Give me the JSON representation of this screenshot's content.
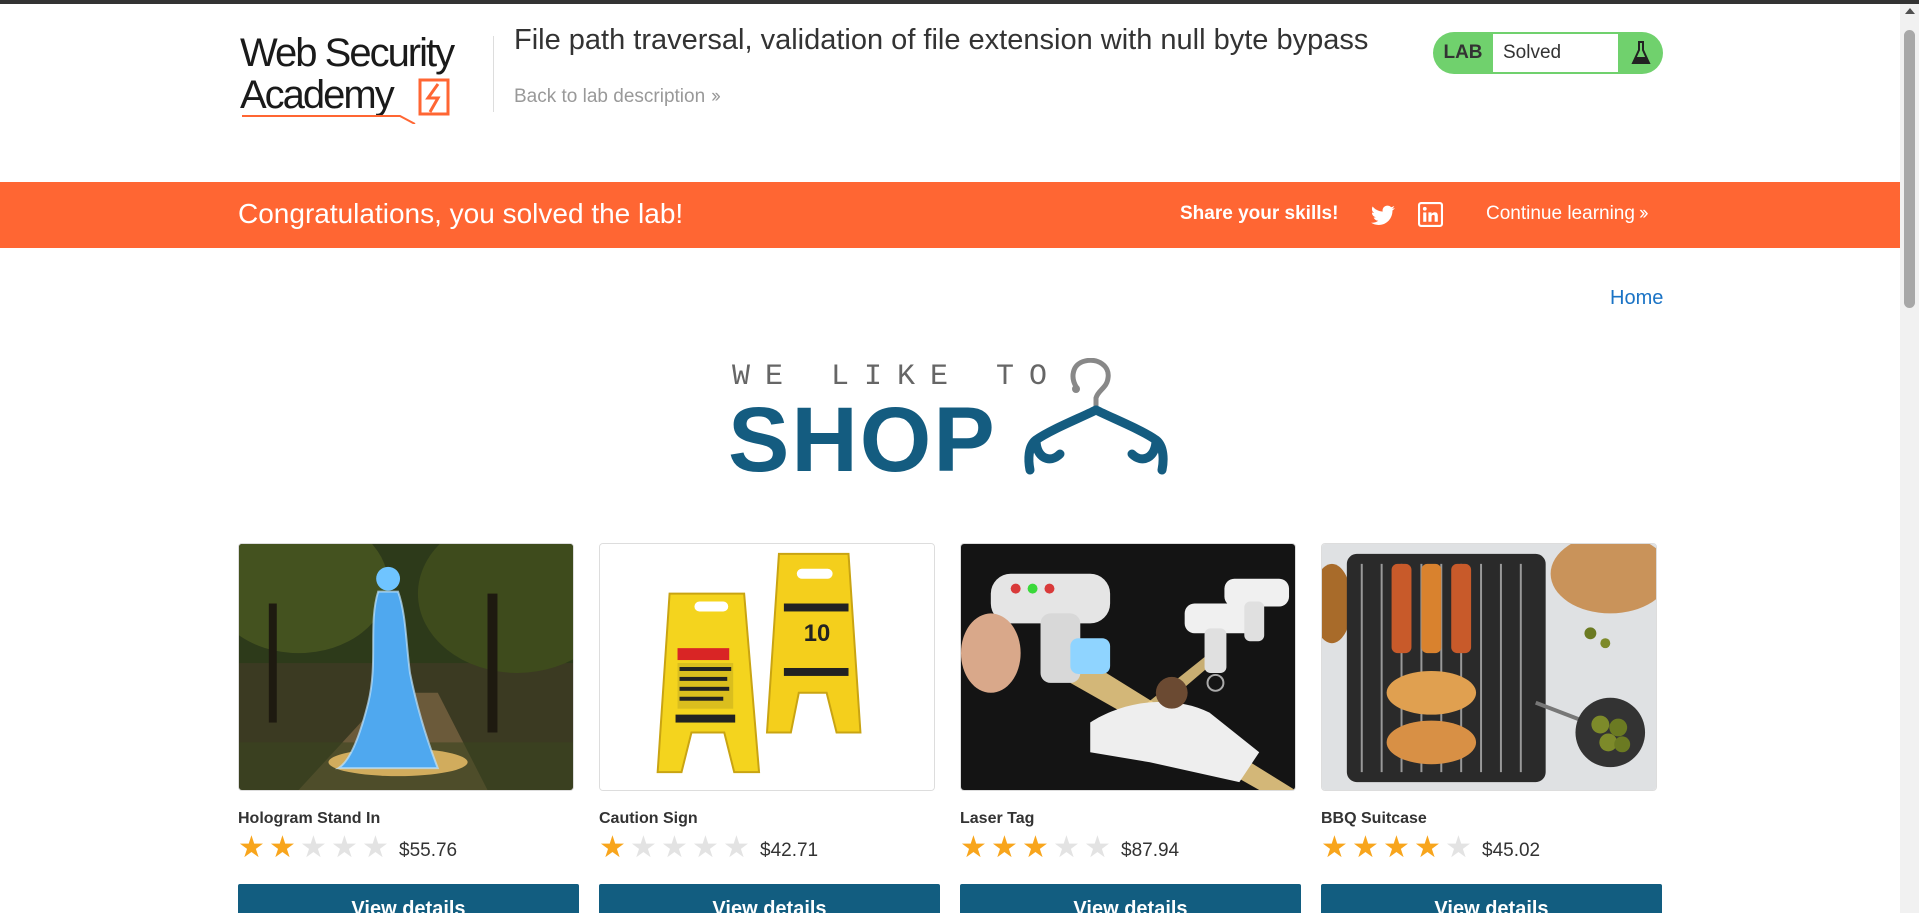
{
  "header": {
    "logo_text_line1": "Web Security",
    "logo_text_line2": "Academy",
    "lab_title": "File path traversal, validation of file extension with null byte bypass",
    "back_link": "Back to lab description",
    "lab_badge": "LAB",
    "lab_status": "Solved"
  },
  "banner": {
    "message": "Congratulations, you solved the lab!",
    "share_label": "Share your skills!",
    "continue_label": "Continue learning"
  },
  "nav": {
    "home": "Home"
  },
  "shop_logo": {
    "tagline": "WE LIKE TO",
    "word": "SHOP"
  },
  "products": [
    {
      "name": "Hologram Stand In",
      "rating": 2,
      "price": "$55.76",
      "button": "View details"
    },
    {
      "name": "Caution Sign",
      "rating": 1,
      "price": "$42.71",
      "button": "View details"
    },
    {
      "name": "Laser Tag",
      "rating": 3,
      "price": "$87.94",
      "button": "View details"
    },
    {
      "name": "BBQ Suitcase",
      "rating": 4,
      "price": "$45.02",
      "button": "View details"
    }
  ],
  "colors": {
    "accent_orange": "#ff6633",
    "lab_green": "#70d16d",
    "button_blue": "#125d80",
    "star_gold": "#f8a51c"
  },
  "icons": [
    "flask-icon",
    "twitter-icon",
    "linkedin-icon",
    "hanger-icon",
    "star-icon"
  ]
}
